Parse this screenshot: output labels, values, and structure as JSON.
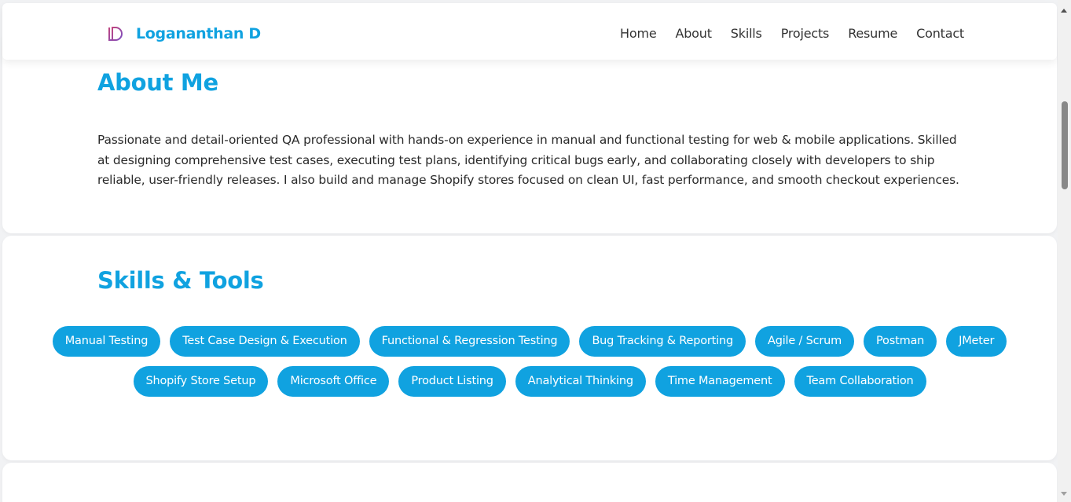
{
  "colors": {
    "accent": "#10a2e0",
    "page_bg": "#f1f2f4",
    "card_bg": "#ffffff",
    "text": "#2a2a2a"
  },
  "header": {
    "logo_icon": "ld-monogram-icon",
    "brand_name": "Logananthan D",
    "nav": [
      "Home",
      "About",
      "Skills",
      "Projects",
      "Resume",
      "Contact"
    ]
  },
  "about": {
    "title": "About Me",
    "body": "Passionate and detail-oriented QA professional with hands-on experience in manual and functional testing for web & mobile applications. Skilled at designing comprehensive test cases, executing test plans, identifying critical bugs early, and collaborating closely with developers to ship reliable, user-friendly releases. I also build and manage Shopify stores focused on clean UI, fast performance, and smooth checkout experiences."
  },
  "skills": {
    "title": "Skills & Tools",
    "items": [
      "Manual Testing",
      "Test Case Design & Execution",
      "Functional & Regression Testing",
      "Bug Tracking & Reporting",
      "Agile / Scrum",
      "Postman",
      "JMeter",
      "Shopify Store Setup",
      "Microsoft Office",
      "Product Listing",
      "Analytical Thinking",
      "Time Management",
      "Team Collaboration"
    ]
  }
}
